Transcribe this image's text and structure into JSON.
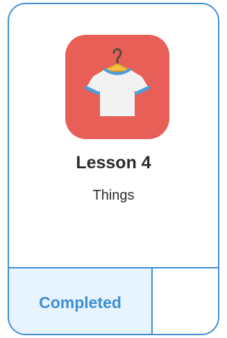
{
  "lesson": {
    "icon": "tshirt-on-hanger-icon",
    "title": "Lesson 4",
    "subtitle": "Things",
    "status": "Completed"
  },
  "colors": {
    "accent": "#3d8fd6",
    "icon_background": "#e85f58",
    "status_background": "#e7f3fd"
  }
}
